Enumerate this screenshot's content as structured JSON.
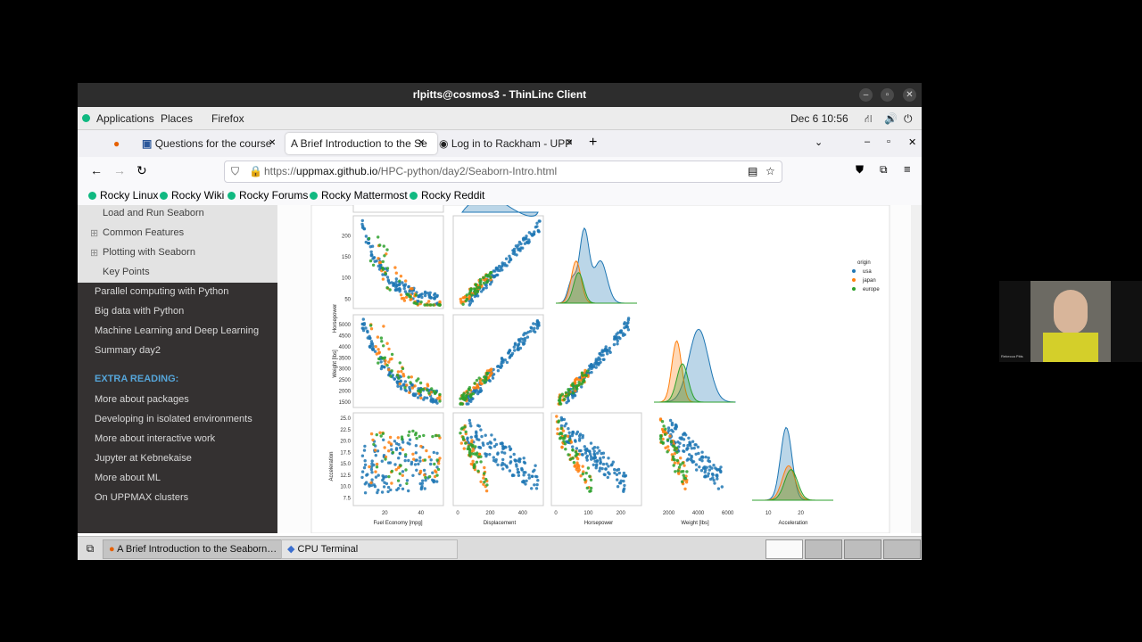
{
  "window": {
    "title": "rlpitts@cosmos3 - ThinLinc Client"
  },
  "gnome_bar": {
    "applications": "Applications",
    "places": "Places",
    "firefox": "Firefox",
    "clock": "Dec 6  10:56"
  },
  "tabs": [
    {
      "label": "Questions for the course"
    },
    {
      "label": "A Brief Introduction to the Se"
    },
    {
      "label": "Log in to Rackham - UPPM"
    }
  ],
  "url": {
    "prefix": "https://",
    "domain": "uppmax.github.io",
    "path": "/HPC-python/day2/Seaborn-Intro.html"
  },
  "bookmarks": [
    "Rocky Linux",
    "Rocky Wiki",
    "Rocky Forums",
    "Rocky Mattermost",
    "Rocky Reddit"
  ],
  "sidebar": {
    "sub_items": [
      "Load and Run Seaborn",
      "Common Features",
      "Plotting with Seaborn",
      "Key Points"
    ],
    "items": [
      "Parallel computing with Python",
      "Big data with Python",
      "Machine Learning and Deep Learning",
      "Summary day2"
    ],
    "extra_heading": "EXTRA READING:",
    "extra_items": [
      "More about packages",
      "Developing in isolated environments",
      "More about interactive work",
      "Jupyter at Kebnekaise",
      "More about ML",
      "On UPPMAX clusters"
    ]
  },
  "chart_data": {
    "type": "scatter",
    "title": "",
    "variables": [
      "Fuel Economy [mpg]",
      "Displacement",
      "Horsepower",
      "Weight [lbs]",
      "Acceleration"
    ],
    "legend": {
      "title": "origin",
      "placement": "right",
      "entries": [
        "usa",
        "japan",
        "europe"
      ]
    },
    "colors": {
      "usa": "#1f77b4",
      "japan": "#ff7f0e",
      "europe": "#2ca02c"
    },
    "y_ticks": {
      "Horsepower": [
        "50",
        "100",
        "150",
        "200"
      ],
      "Weight [lbs]": [
        "1500",
        "2000",
        "2500",
        "3000",
        "3500",
        "4000",
        "4500",
        "5000"
      ],
      "Acceleration": [
        "7.5",
        "10.0",
        "12.5",
        "15.0",
        "17.5",
        "20.0",
        "22.5",
        "25.0"
      ]
    },
    "x_ticks": {
      "Fuel Economy [mpg]": [
        "20",
        "40"
      ],
      "Displacement": [
        "0",
        "200",
        "400"
      ],
      "Horsepower": [
        "0",
        "100",
        "200"
      ],
      "Weight [lbs]": [
        "2000",
        "4000",
        "6000"
      ],
      "Acceleration": [
        "10",
        "20"
      ]
    },
    "ylim": {
      "Horsepower": [
        40,
        235
      ],
      "Weight [lbs]": [
        1500,
        5200
      ],
      "Acceleration": [
        7,
        25
      ]
    },
    "xlim": {
      "Fuel Economy [mpg]": [
        5,
        50
      ],
      "Displacement": [
        0,
        500
      ],
      "Horsepower": [
        0,
        250
      ],
      "Weight [lbs]": [
        1000,
        6500
      ],
      "Acceleration": [
        5,
        30
      ]
    }
  },
  "taskbar": {
    "item1": "A Brief Introduction to the Seaborn…",
    "item2": "CPU Terminal"
  },
  "webcam": {
    "name": "Rebecca Pitts"
  }
}
